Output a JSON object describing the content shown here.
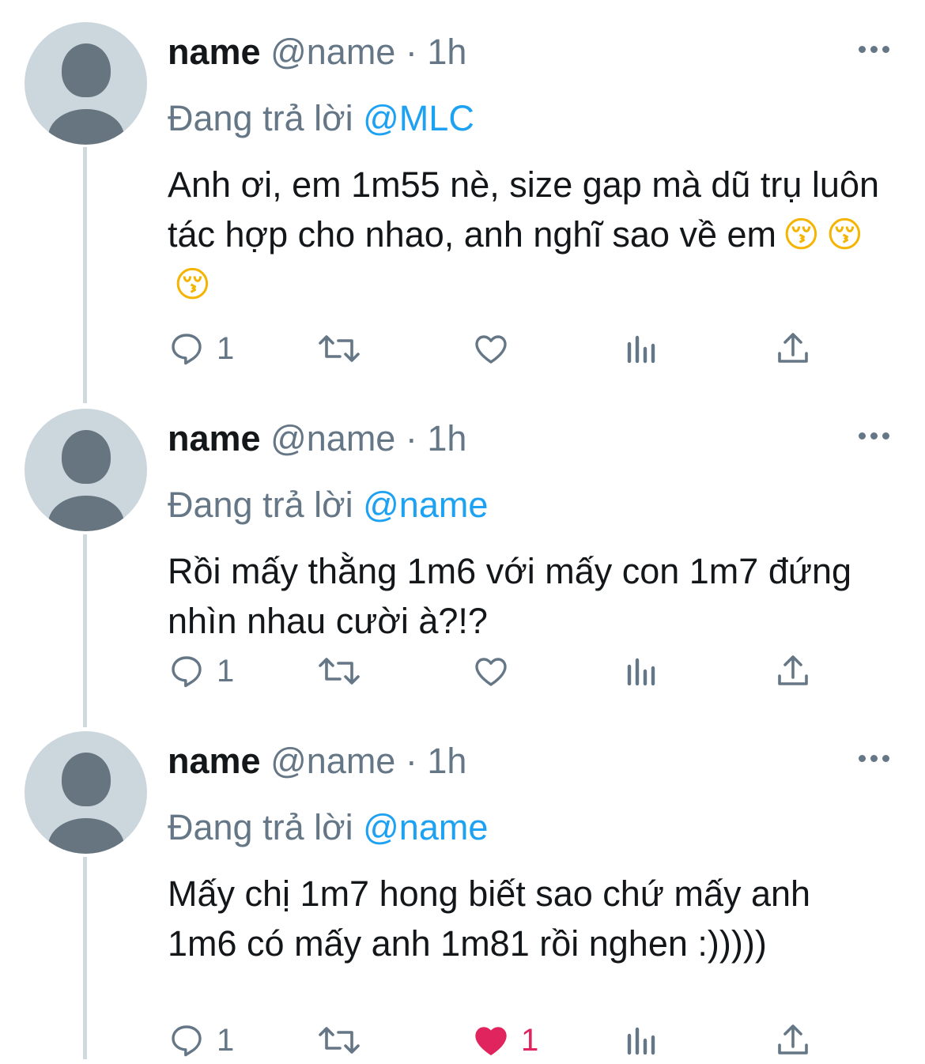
{
  "tweets": [
    {
      "display_name": "name",
      "handle": "@name",
      "separator": "·",
      "time": "1h",
      "reply_prefix": "Đang trả lời",
      "reply_to": "@MLC",
      "text": "Anh ơi, em 1m55 nè, size gap mà dũ trụ luôn tác hợp cho nhao, anh nghĩ sao về em",
      "emojis": [
        "😚",
        "😚",
        "😚"
      ],
      "replies": "1",
      "retweets": "",
      "likes": "",
      "liked": false
    },
    {
      "display_name": "name",
      "handle": "@name",
      "separator": "·",
      "time": "1h",
      "reply_prefix": "Đang trả lời",
      "reply_to": "@name",
      "text": "Rồi mấy thằng 1m6 với mấy con 1m7 đứng nhìn nhau cười à?!?",
      "emojis": [],
      "replies": "1",
      "retweets": "",
      "likes": "",
      "liked": false
    },
    {
      "display_name": "name",
      "handle": "@name",
      "separator": "·",
      "time": "1h",
      "reply_prefix": "Đang trả lời",
      "reply_to": "@name",
      "text": "Mấy chị 1m7 hong biết sao chứ mấy anh 1m6 có mấy anh 1m81 rồi nghen :)))))",
      "emojis": [],
      "replies": "1",
      "retweets": "",
      "likes": "1",
      "liked": true
    }
  ],
  "colors": {
    "text": "#14171a",
    "secondary": "#657786",
    "mention": "#1da1f2",
    "like_active": "#e0245e",
    "thread_line": "#cfd9de",
    "avatar_bg": "#ccd6dd"
  },
  "icons": [
    "reply-icon",
    "retweet-icon",
    "heart-icon",
    "analytics-icon",
    "share-icon",
    "more-icon"
  ]
}
